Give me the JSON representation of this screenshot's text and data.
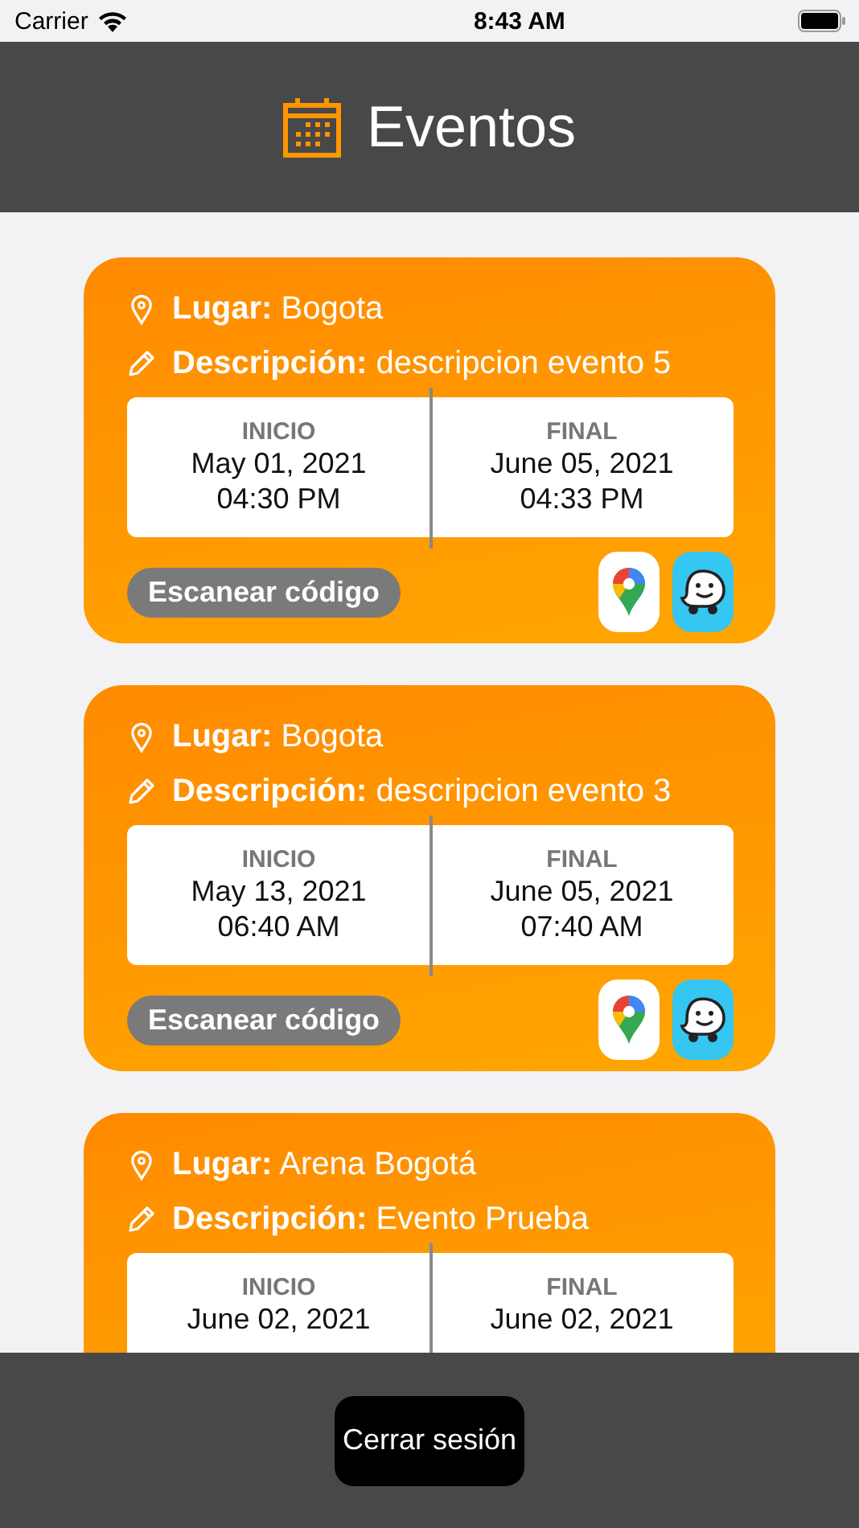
{
  "status_bar": {
    "carrier": "Carrier",
    "time": "8:43 AM"
  },
  "header": {
    "title": "Eventos"
  },
  "events": [
    {
      "place_label": "Lugar:",
      "place": "Bogota",
      "description_label": "Descripción:",
      "description": "descripcion evento 5",
      "start": {
        "label": "INICIO",
        "date": "May 01, 2021",
        "time": "04:30 PM"
      },
      "end": {
        "label": "FINAL",
        "date": "June 05, 2021",
        "time": "04:33 PM"
      },
      "scan_button": "Escanear código"
    },
    {
      "place_label": "Lugar:",
      "place": "Bogota",
      "description_label": "Descripción:",
      "description": "descripcion evento 3",
      "start": {
        "label": "INICIO",
        "date": "May 13, 2021",
        "time": "06:40 AM"
      },
      "end": {
        "label": "FINAL",
        "date": "June 05, 2021",
        "time": "07:40 AM"
      },
      "scan_button": "Escanear código"
    },
    {
      "place_label": "Lugar:",
      "place": "Arena Bogotá",
      "description_label": "Descripción:",
      "description": "Evento Prueba",
      "start": {
        "label": "INICIO",
        "date": "June 02, 2021"
      },
      "end": {
        "label": "FINAL",
        "date": "June 02, 2021"
      }
    }
  ],
  "logout_button": "Cerrar sesión"
}
